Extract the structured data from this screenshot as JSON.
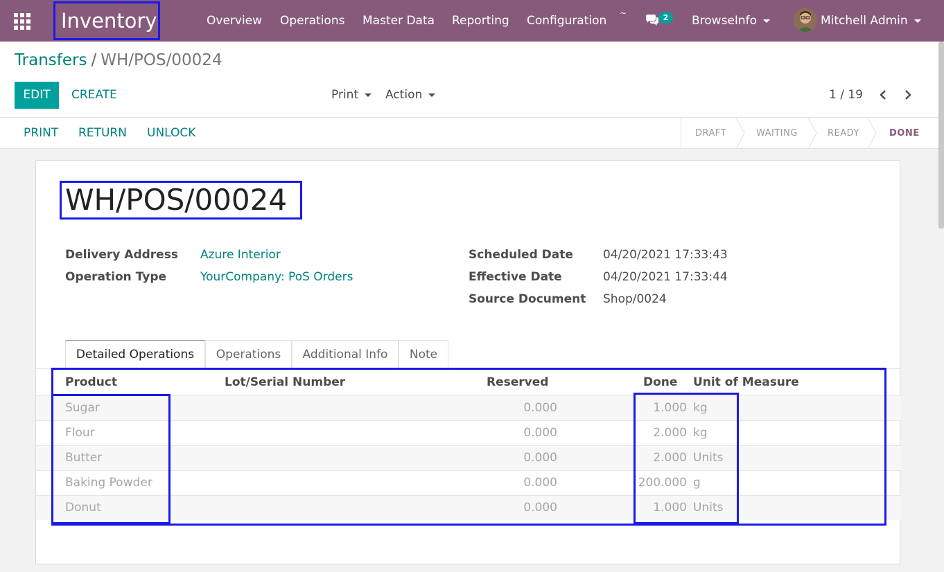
{
  "navbar": {
    "app_name": "Inventory",
    "menus": [
      "Overview",
      "Operations",
      "Master Data",
      "Reporting",
      "Configuration"
    ],
    "tilde": "~",
    "chat_badge": "2",
    "browse": "BrowseInfo",
    "user": "Mitchell Admin"
  },
  "breadcrumb": {
    "parent": "Transfers",
    "separator": "/",
    "current": "WH/POS/00024"
  },
  "buttons": {
    "edit": "EDIT",
    "create": "CREATE",
    "print": "Print",
    "action": "Action"
  },
  "pager": {
    "value": "1 / 19"
  },
  "statusbar": {
    "actions": [
      "PRINT",
      "RETURN",
      "UNLOCK"
    ],
    "stages": [
      "DRAFT",
      "WAITING",
      "READY",
      "DONE"
    ],
    "active_stage": "DONE"
  },
  "record": {
    "name": "WH/POS/00024",
    "delivery_address_label": "Delivery Address",
    "delivery_address": "Azure Interior",
    "operation_type_label": "Operation Type",
    "operation_type": "YourCompany: PoS Orders",
    "scheduled_date_label": "Scheduled Date",
    "scheduled_date": "04/20/2021 17:33:43",
    "effective_date_label": "Effective Date",
    "effective_date": "04/20/2021 17:33:44",
    "source_document_label": "Source Document",
    "source_document": "Shop/0024"
  },
  "tabs": [
    "Detailed Operations",
    "Operations",
    "Additional Info",
    "Note"
  ],
  "table": {
    "headers": {
      "product": "Product",
      "lot": "Lot/Serial Number",
      "reserved": "Reserved",
      "done": "Done",
      "uom": "Unit of Measure"
    },
    "rows": [
      {
        "product": "Sugar",
        "reserved": "0.000",
        "done": "1.000",
        "uom": "kg"
      },
      {
        "product": "Flour",
        "reserved": "0.000",
        "done": "2.000",
        "uom": "kg"
      },
      {
        "product": "Butter",
        "reserved": "0.000",
        "done": "2.000",
        "uom": "Units"
      },
      {
        "product": "Baking Powder",
        "reserved": "0.000",
        "done": "200.000",
        "uom": "g"
      },
      {
        "product": "Donut",
        "reserved": "0.000",
        "done": "1.000",
        "uom": "Units"
      }
    ]
  },
  "colors": {
    "brand": "#875a7b",
    "accent": "#00a09d",
    "link": "#00827f",
    "highlight": "#1a1ae6"
  }
}
